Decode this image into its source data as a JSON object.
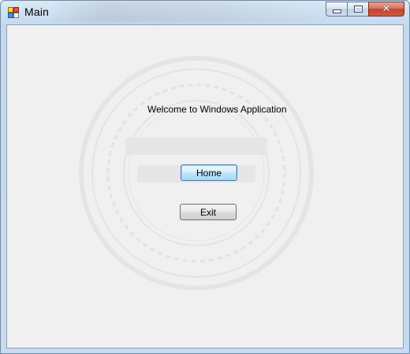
{
  "window": {
    "title": "Main",
    "caption": {
      "minimize_icon": "minimize-icon",
      "maximize_icon": "maximize-icon",
      "close_glyph": "✕"
    }
  },
  "main": {
    "welcome_text": "Welcome to Windows Application",
    "home_label": "Home",
    "exit_label": "Exit"
  },
  "colors": {
    "client_bg": "#f0f0f0",
    "close_red": "#c4442c",
    "focus_blue": "#3c7fb1"
  }
}
